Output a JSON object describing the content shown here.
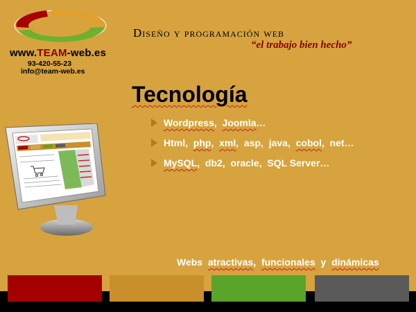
{
  "logo": {
    "url_prefix": "www.",
    "url_brand": "TEAM",
    "url_suffix": "-web.es",
    "phone": "93-420-55-23",
    "email": "info@team-web.es",
    "ring_colors": [
      "#A80000",
      "#E0A030",
      "#6FB02F"
    ]
  },
  "header": {
    "title": "Diseño y programación web",
    "slogan": "“el trabajo bien hecho”"
  },
  "main": {
    "title": "Tecnología",
    "items": [
      {
        "parts": [
          "Wordpress",
          ",  ",
          "Joomla",
          "…"
        ]
      },
      {
        "parts": [
          "Html,  ",
          "php",
          ",  ",
          "xml",
          ",  asp,  java,  ",
          "cobol",
          ",  net…"
        ]
      },
      {
        "parts": [
          "MySQL",
          ",  db2,  oracle,  SQL Server…"
        ]
      }
    ]
  },
  "footer": {
    "tagline_parts": [
      "Webs  ",
      "atractivas",
      ",  ",
      "funcionales",
      "  y  ",
      "dinámicas"
    ]
  },
  "colors": {
    "background": "#D6A33E",
    "bar_red": "#A50000",
    "bar_gold": "#C98F2A",
    "bar_green": "#58A52A",
    "bar_gray": "#5A5A5A"
  }
}
